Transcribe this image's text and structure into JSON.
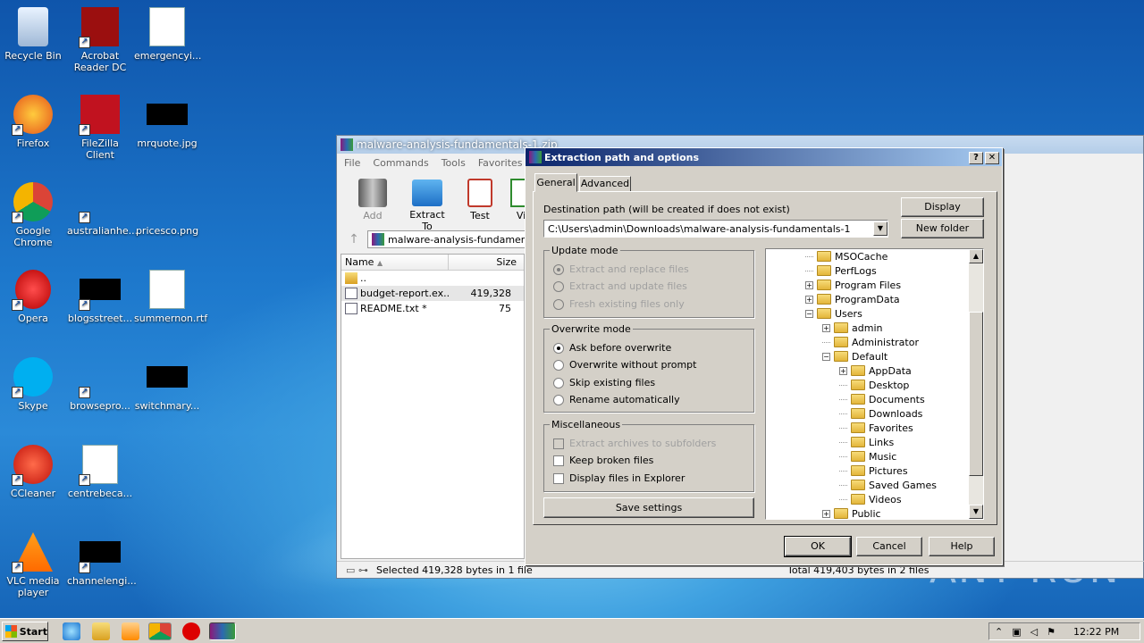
{
  "desktop": {
    "icons": [
      {
        "label": "Recycle Bin",
        "icon": "recycle-bin-icon"
      },
      {
        "label": "Acrobat Reader DC",
        "icon": "acrobat-icon"
      },
      {
        "label": "emergencyi...",
        "icon": "word-doc-icon"
      },
      {
        "label": "Firefox",
        "icon": "firefox-icon"
      },
      {
        "label": "FileZilla Client",
        "icon": "filezilla-icon"
      },
      {
        "label": "mrquote.jpg",
        "icon": "image-file-icon"
      },
      {
        "label": "Google Chrome",
        "icon": "chrome-icon"
      },
      {
        "label": "australianhe...",
        "icon": "file-icon"
      },
      {
        "label": "pricesco.png",
        "icon": "image-file-icon"
      },
      {
        "label": "Opera",
        "icon": "opera-icon"
      },
      {
        "label": "blogsstreet...",
        "icon": "file-icon"
      },
      {
        "label": "summernon.rtf",
        "icon": "word-doc-icon"
      },
      {
        "label": "Skype",
        "icon": "skype-icon"
      },
      {
        "label": "browsepro...",
        "icon": "file-icon"
      },
      {
        "label": "switchmary...",
        "icon": "file-icon"
      },
      {
        "label": "CCleaner",
        "icon": "ccleaner-icon"
      },
      {
        "label": "centrebeca...",
        "icon": "word-doc-icon"
      },
      {
        "label": "VLC media player",
        "icon": "vlc-icon"
      },
      {
        "label": "channelengi...",
        "icon": "file-icon"
      }
    ]
  },
  "winrar": {
    "title": "malware-analysis-fundamentals-1.zip",
    "menu": [
      "File",
      "Commands",
      "Tools",
      "Favorites",
      "Opt"
    ],
    "toolbar": [
      "Add",
      "Extract To",
      "Test",
      "Vi"
    ],
    "path": "malware-analysis-fundamen",
    "columns": {
      "name": "Name",
      "size": "Size"
    },
    "files": [
      {
        "name": "..",
        "size": ""
      },
      {
        "name": "budget-report.ex...",
        "size": "419,328"
      },
      {
        "name": "README.txt *",
        "size": "75"
      }
    ],
    "status_left": "Selected 419,328 bytes in 1 file",
    "status_right": "Total 419,403 bytes in 2 files"
  },
  "dialog": {
    "title": "Extraction path and options",
    "help_glyph": "?",
    "close_glyph": "✕",
    "tabs": [
      "General",
      "Advanced"
    ],
    "dest_label": "Destination path (will be created if does not exist)",
    "dest_value": "C:\\Users\\admin\\Downloads\\malware-analysis-fundamentals-1",
    "display_btn": "Display",
    "new_folder_btn": "New folder",
    "update_mode": {
      "title": "Update mode",
      "options": [
        "Extract and replace files",
        "Extract and update files",
        "Fresh existing files only"
      ],
      "selected": 0,
      "disabled": true
    },
    "overwrite_mode": {
      "title": "Overwrite mode",
      "options": [
        "Ask before overwrite",
        "Overwrite without prompt",
        "Skip existing files",
        "Rename automatically"
      ],
      "selected": 0
    },
    "misc": {
      "title": "Miscellaneous",
      "options": [
        {
          "label": "Extract archives to subfolders",
          "checked": false,
          "disabled": true
        },
        {
          "label": "Keep broken files",
          "checked": false,
          "disabled": false
        },
        {
          "label": "Display files in Explorer",
          "checked": false,
          "disabled": false
        }
      ]
    },
    "save_btn": "Save settings",
    "tree": [
      {
        "label": "MSOCache",
        "level": 3,
        "pm": ""
      },
      {
        "label": "PerfLogs",
        "level": 3,
        "pm": ""
      },
      {
        "label": "Program Files",
        "level": 3,
        "pm": "+"
      },
      {
        "label": "ProgramData",
        "level": 3,
        "pm": "+"
      },
      {
        "label": "Users",
        "level": 3,
        "pm": "-"
      },
      {
        "label": "admin",
        "level": 4,
        "pm": "+"
      },
      {
        "label": "Administrator",
        "level": 4,
        "pm": ""
      },
      {
        "label": "Default",
        "level": 4,
        "pm": "-"
      },
      {
        "label": "AppData",
        "level": 5,
        "pm": "+"
      },
      {
        "label": "Desktop",
        "level": 5,
        "pm": ""
      },
      {
        "label": "Documents",
        "level": 5,
        "pm": ""
      },
      {
        "label": "Downloads",
        "level": 5,
        "pm": ""
      },
      {
        "label": "Favorites",
        "level": 5,
        "pm": ""
      },
      {
        "label": "Links",
        "level": 5,
        "pm": ""
      },
      {
        "label": "Music",
        "level": 5,
        "pm": ""
      },
      {
        "label": "Pictures",
        "level": 5,
        "pm": ""
      },
      {
        "label": "Saved Games",
        "level": 5,
        "pm": ""
      },
      {
        "label": "Videos",
        "level": 5,
        "pm": ""
      },
      {
        "label": "Public",
        "level": 4,
        "pm": "+"
      }
    ],
    "ok": "OK",
    "cancel": "Cancel",
    "help": "Help"
  },
  "taskbar": {
    "start": "Start",
    "clock": "12:22 PM"
  },
  "watermark": "ANY RUN"
}
